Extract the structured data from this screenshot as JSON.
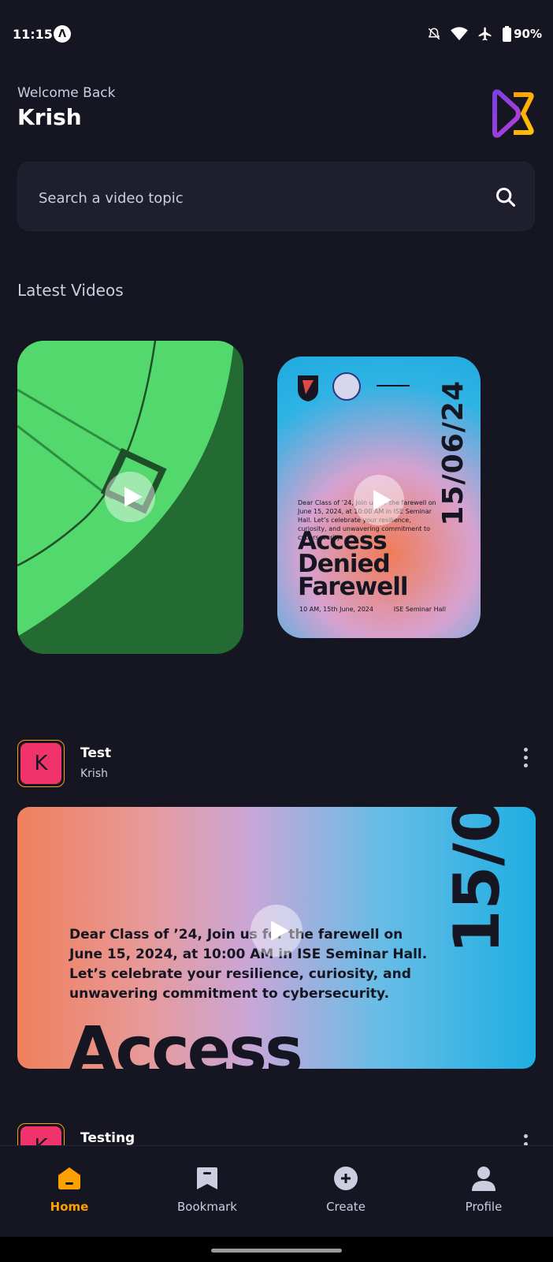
{
  "status_bar": {
    "time": "11:15",
    "battery": "90%"
  },
  "header": {
    "welcome": "Welcome Back",
    "username": "Krish"
  },
  "search": {
    "placeholder": "Search a video topic"
  },
  "latest": {
    "title": "Latest Videos",
    "card2": {
      "date": "15/06/24",
      "text": "Dear Class of ’24, Join us for the farewell on June 15, 2024, at 10:00 AM in ISE Seminar Hall. Let’s celebrate your resilience, curiosity, and unwavering commitment to cybersecurity.",
      "title": "Access Denied Farewell",
      "footer_left": "10 AM, 15th June, 2024",
      "footer_right": "ISE Seminar Hall"
    }
  },
  "posts": [
    {
      "avatar": "K",
      "title": "Test",
      "author": "Krish",
      "thumb": {
        "text": "Dear Class of ’24, Join us for the farewell on June 15, 2024, at 10:00 AM in ISE Seminar Hall. Let’s celebrate your resilience, curiosity, and unwavering commitment to cybersecurity.",
        "big": "Access",
        "date": "15/0"
      }
    },
    {
      "avatar": "K",
      "title": "Testing"
    }
  ],
  "tabs": [
    {
      "label": "Home",
      "icon": "home-icon"
    },
    {
      "label": "Bookmark",
      "icon": "bookmark-icon"
    },
    {
      "label": "Create",
      "icon": "plus-circle-icon"
    },
    {
      "label": "Profile",
      "icon": "profile-icon"
    }
  ],
  "colors": {
    "background": "#161622",
    "accent": "#FFA001",
    "avatar": "#F0336B",
    "card": "#1E1E2D"
  }
}
